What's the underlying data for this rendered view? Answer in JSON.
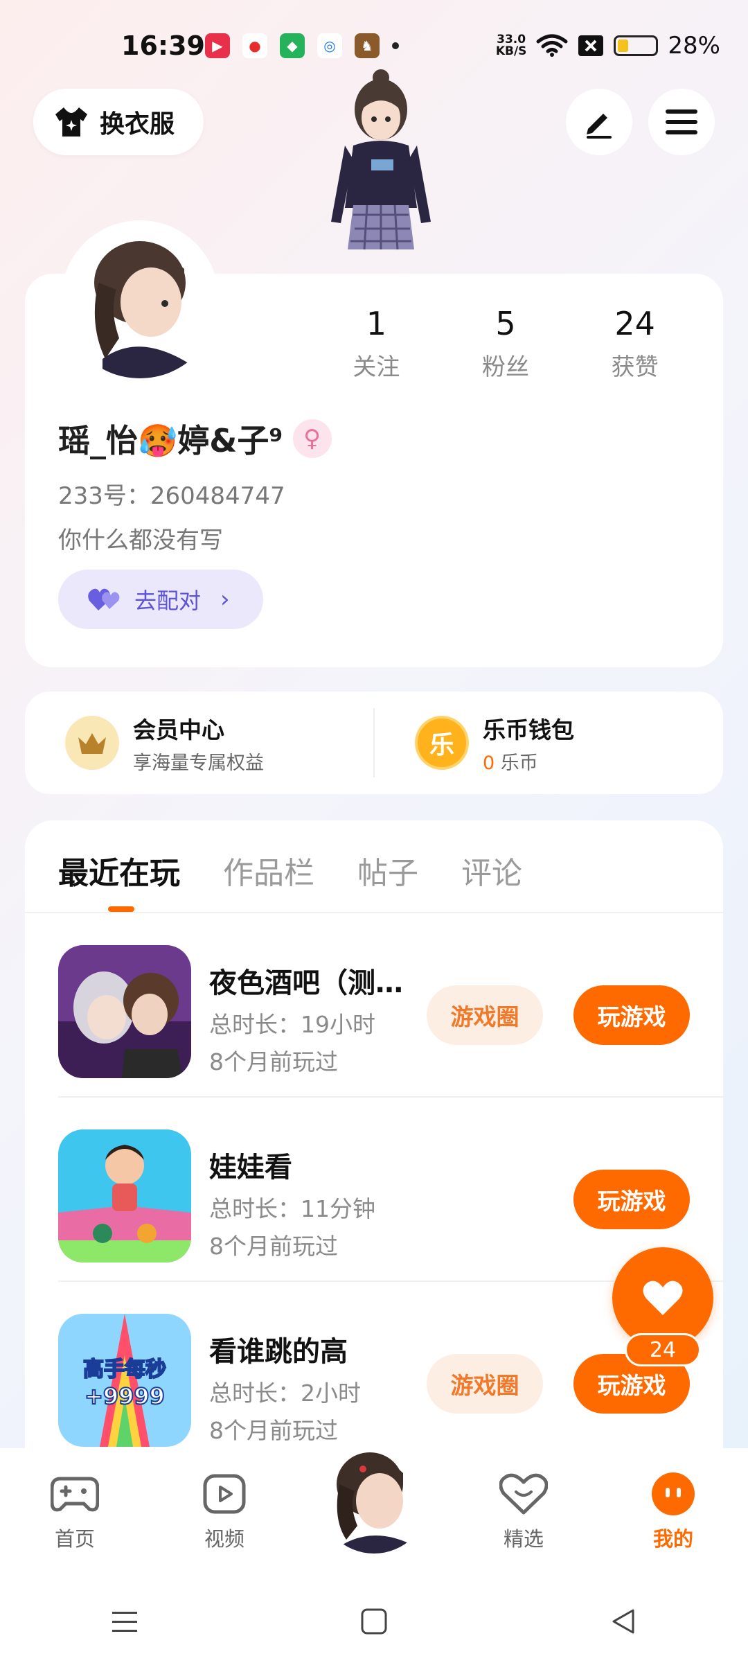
{
  "status_bar": {
    "time": "16:39",
    "net_speed_top": "33.0",
    "net_speed_unit": "KB/S",
    "battery": "28%",
    "battery_level": 0.28
  },
  "header": {
    "outfit_label": "换衣服",
    "edit_icon": "pen-icon",
    "menu_icon": "menu-icon"
  },
  "profile": {
    "stats": [
      {
        "value": "1",
        "label": "关注"
      },
      {
        "value": "5",
        "label": "粉丝"
      },
      {
        "value": "24",
        "label": "获赞"
      }
    ],
    "username": "瑶_怡🥵婷&子⁹",
    "uid": "233号：260484747",
    "bio": "你什么都没有写",
    "pair_label": "去配对"
  },
  "member": {
    "vip_title": "会员中心",
    "vip_sub": "享海量专属权益",
    "wallet_title": "乐币钱包",
    "wallet_icon_char": "乐",
    "wallet_amount": "0",
    "wallet_unit": "乐币"
  },
  "tabs": [
    "最近在玩",
    "作品栏",
    "帖子",
    "评论"
  ],
  "games": [
    {
      "title": "夜色酒吧（测试服）",
      "duration": "总时长：19小时",
      "last_played": "8个月前玩过",
      "circle_label": "游戏圈",
      "play_label": "玩游戏"
    },
    {
      "title": "娃娃看",
      "duration": "总时长：11分钟",
      "last_played": "8个月前玩过",
      "play_label": "玩游戏"
    },
    {
      "title": "看谁跳的高",
      "duration": "总时长：2小时",
      "last_played": "8个月前玩过",
      "circle_label": "游戏圈",
      "play_label": "玩游戏",
      "icon_text_1": "高手每秒",
      "icon_text_2": "+9999"
    }
  ],
  "like_fab": {
    "count": "24"
  },
  "bottom_nav": [
    {
      "label": "首页",
      "icon": "gamepad-icon"
    },
    {
      "label": "视频",
      "icon": "video-icon"
    },
    {
      "label": "",
      "icon": "avatar"
    },
    {
      "label": "精选",
      "icon": "heart-badge-icon"
    },
    {
      "label": "我的",
      "icon": "profile-icon"
    }
  ],
  "colors": {
    "accent": "#ff6a00",
    "pair": "#5d53d6"
  }
}
